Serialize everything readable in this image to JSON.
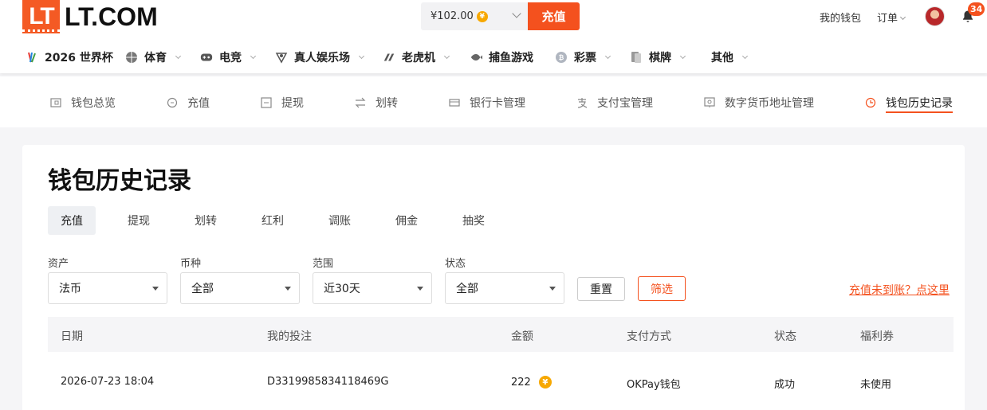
{
  "header": {
    "logo_mark": "LT",
    "logo_text": "LT.COM",
    "balance": "¥102.00",
    "currency_symbol": "¥",
    "deposit_label": "充值",
    "wallet_label": "我的钱包",
    "orders_label": "订单",
    "notification_count": "34",
    "accent_color": "#f4511e"
  },
  "nav": [
    {
      "label": "2026 世界杯",
      "icon": "world-cup-icon"
    },
    {
      "label": "体育",
      "icon": "basketball-icon"
    },
    {
      "label": "电竞",
      "icon": "gamepad-icon"
    },
    {
      "label": "真人娱乐场",
      "icon": "dealer-icon"
    },
    {
      "label": "老虎机",
      "icon": "slot-icon"
    },
    {
      "label": "捕鱼游戏",
      "icon": "fish-icon"
    },
    {
      "label": "彩票",
      "icon": "lottery-icon"
    },
    {
      "label": "棋牌",
      "icon": "cards-icon"
    },
    {
      "label": "其他",
      "icon": ""
    }
  ],
  "subnav": [
    {
      "label": "钱包总览",
      "icon": "wallet-icon"
    },
    {
      "label": "充值",
      "icon": "deposit-icon"
    },
    {
      "label": "提现",
      "icon": "withdraw-icon"
    },
    {
      "label": "划转",
      "icon": "transfer-icon"
    },
    {
      "label": "银行卡管理",
      "icon": "bank-card-icon"
    },
    {
      "label": "支付宝管理",
      "icon": "alipay-icon"
    },
    {
      "label": "数字货币地址管理",
      "icon": "crypto-address-icon"
    },
    {
      "label": "钱包历史记录",
      "icon": "clock-icon"
    }
  ],
  "page": {
    "title": "钱包历史记录",
    "tabs": [
      "充值",
      "提现",
      "划转",
      "红利",
      "调账",
      "佣金",
      "抽奖"
    ],
    "active_tab": "充值"
  },
  "filters": [
    {
      "label": "资产",
      "value": "法币"
    },
    {
      "label": "币种",
      "value": "全部"
    },
    {
      "label": "范围",
      "value": "近30天"
    },
    {
      "label": "状态",
      "value": "全部"
    }
  ],
  "buttons": {
    "reset": "重置",
    "filter": "筛选",
    "help_link": "充值未到账？点这里"
  },
  "table": {
    "columns": [
      "日期",
      "我的投注",
      "金额",
      "支付方式",
      "状态",
      "福利券"
    ],
    "rows": [
      {
        "date": "2026-07-23 18:04",
        "bet_id": "D3319985834118469G",
        "amount": "222",
        "method": "OKPay钱包",
        "status": "成功",
        "coupon": "未使用"
      }
    ]
  }
}
